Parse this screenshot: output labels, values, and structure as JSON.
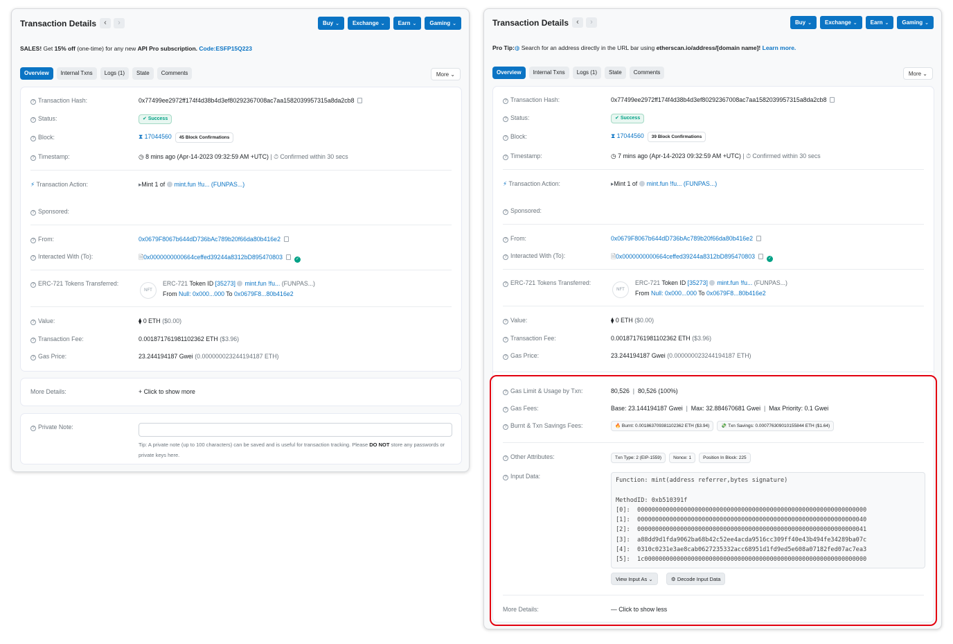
{
  "left": {
    "title": "Transaction Details",
    "nav": {
      "prev": "‹",
      "next": "›"
    },
    "menu": [
      "Buy",
      "Exchange",
      "Earn",
      "Gaming"
    ],
    "promo": {
      "p1": "SALES!",
      "p2": " Get ",
      "p3": "15% off",
      "p4": " (one-time) for any new ",
      "p5": "API Pro subscription.",
      "p6": " Code:ESFP15Q223"
    },
    "tabs": [
      "Overview",
      "Internal Txns",
      "Logs (1)",
      "State",
      "Comments"
    ],
    "more": "More",
    "rows": {
      "hash_label": "Transaction Hash:",
      "hash": "0x77499ee2972ff174f4d38b4d3ef80292367008ac7aa1582039957315a8da2cb8",
      "status_label": "Status:",
      "status": "Success",
      "block_label": "Block:",
      "block": "17044560",
      "confirmations": "45 Block Confirmations",
      "timestamp_label": "Timestamp:",
      "timestamp": "8 mins ago (Apr-14-2023 09:32:59 AM +UTC)",
      "confirmed": "Confirmed within 30 secs",
      "action_label": "Transaction Action:",
      "action_prefix": "Mint 1 of",
      "action_token": "mint.fun !fu... (FUNPAS...)",
      "sponsored_label": "Sponsored:",
      "from_label": "From:",
      "from": "0x0679F8067b644dD736bAc789b20f66da80b416e2",
      "to_label": "Interacted With (To):",
      "to": "0x0000000000664ceffed39244a8312bD895470803",
      "erc_label": "ERC-721 Tokens Transferred:",
      "erc_pre": "ERC-721",
      "erc_tokenid": " Token ID ",
      "erc_id": "[35273]",
      "erc_token": "mint.fun !fu...",
      "erc_sym": " (FUNPAS...)",
      "erc_from": "From ",
      "erc_null": "Null: 0x000...000",
      "erc_to": " To ",
      "erc_toaddr": "0x0679F8...80b416e2",
      "nft": "NFT",
      "value_label": "Value:",
      "value": "0 ETH",
      "value_usd": " ($0.00)",
      "fee_label": "Transaction Fee:",
      "fee": "0.001871761981102362 ETH",
      "fee_usd": " ($3.96)",
      "gas_label": "Gas Price:",
      "gas": "23.244194187 Gwei",
      "gas_eth": " (0.000000023244194187 ETH)"
    },
    "more_details_label": "More Details:",
    "more_details_link": "+ Click to show more",
    "note_label": "Private Note:",
    "tip": {
      "t1": "Tip: A private note (up to 100 characters) can be saved and is useful for transaction tracking. Please ",
      "t2": "DO NOT",
      "t3": " store any passwords or private keys here."
    }
  },
  "right": {
    "title": "Transaction Details",
    "nav": {
      "prev": "‹",
      "next": "›"
    },
    "menu": [
      "Buy",
      "Exchange",
      "Earn",
      "Gaming"
    ],
    "protip": {
      "p1": "Pro Tip:",
      "p2": " Search for an address directly in the URL bar using ",
      "p3": "etherscan.io/address/[domain name]!",
      "p4": " Learn more."
    },
    "tabs": [
      "Overview",
      "Internal Txns",
      "Logs (1)",
      "State",
      "Comments"
    ],
    "more": "More",
    "rows": {
      "hash_label": "Transaction Hash:",
      "hash": "0x77499ee2972ff174f4d38b4d3ef80292367008ac7aa1582039957315a8da2cb8",
      "status_label": "Status:",
      "status": "Success",
      "block_label": "Block:",
      "block": "17044560",
      "confirmations": "39 Block Confirmations",
      "timestamp_label": "Timestamp:",
      "timestamp": "7 mins ago (Apr-14-2023 09:32:59 AM +UTC)",
      "confirmed": "Confirmed within 30 secs",
      "action_label": "Transaction Action:",
      "action_prefix": "Mint 1 of",
      "action_token": "mint.fun !fu... (FUNPAS...)",
      "sponsored_label": "Sponsored:",
      "from_label": "From:",
      "from": "0x0679F8067b644dD736bAc789b20f66da80b416e2",
      "to_label": "Interacted With (To):",
      "to": "0x0000000000664ceffed39244a8312bD895470803",
      "erc_label": "ERC-721 Tokens Transferred:",
      "erc_pre": "ERC-721",
      "erc_tokenid": " Token ID ",
      "erc_id": "[35273]",
      "erc_token": "mint.fun !fu...",
      "erc_sym": " (FUNPAS...)",
      "erc_from": "From ",
      "erc_null": "Null: 0x000...000",
      "erc_to": " To ",
      "erc_toaddr": "0x0679F8...80b416e2",
      "nft": "NFT",
      "value_label": "Value:",
      "value": "0 ETH",
      "value_usd": " ($0.00)",
      "fee_label": "Transaction Fee:",
      "fee": "0.001871761981102362 ETH",
      "fee_usd": " ($3.96)",
      "gas_label": "Gas Price:",
      "gas": "23.244194187 Gwei",
      "gas_eth": " (0.000000023244194187 ETH)"
    },
    "extra": {
      "gaslimit_label": "Gas Limit & Usage by Txn:",
      "gaslimit": "80,526",
      "gasusage": "80,526 (100%)",
      "gasfees_label": "Gas Fees:",
      "base": "Base: 23.144194187 Gwei",
      "max": "Max: 32.884670681 Gwei",
      "maxprio": "Max Priority: 0.1 Gwei",
      "burnt_label": "Burnt & Txn Savings Fees:",
      "burnt": "Burnt: 0.001863709381102362 ETH ($3.94)",
      "savings": "Txn Savings: 0.000776309010155844 ETH ($1.64)",
      "other_label": "Other Attributes:",
      "txntype": "Txn Type: 2 (EIP-1559)",
      "nonce": "Nonce: 1",
      "position": "Position In Block: 225",
      "input_label": "Input Data:",
      "input_code": "Function: mint(address referrer,bytes signature)\n\nMethodID: 0xb510391f\n[0]:  0000000000000000000000000000000000000000000000000000000000000000\n[1]:  0000000000000000000000000000000000000000000000000000000000000040\n[2]:  0000000000000000000000000000000000000000000000000000000000000041\n[3]:  a88dd9d1fda9062ba68b42c52ee4acda9516cc309ff40e43b494fe34289ba07c\n[4]:  0310c0231e3ae8cab0627235332acc68951d1fd9ed5e608a07182fed07ac7ea3\n[5]:  1c00000000000000000000000000000000000000000000000000000000000000",
      "view_input": "View Input As",
      "decode": "Decode Input Data",
      "more_details_label": "More Details:",
      "less_link": "— Click to show less"
    }
  },
  "colors": {
    "accent": "#0b74c4",
    "success": "#00a186",
    "highlight": "#e3000f"
  }
}
